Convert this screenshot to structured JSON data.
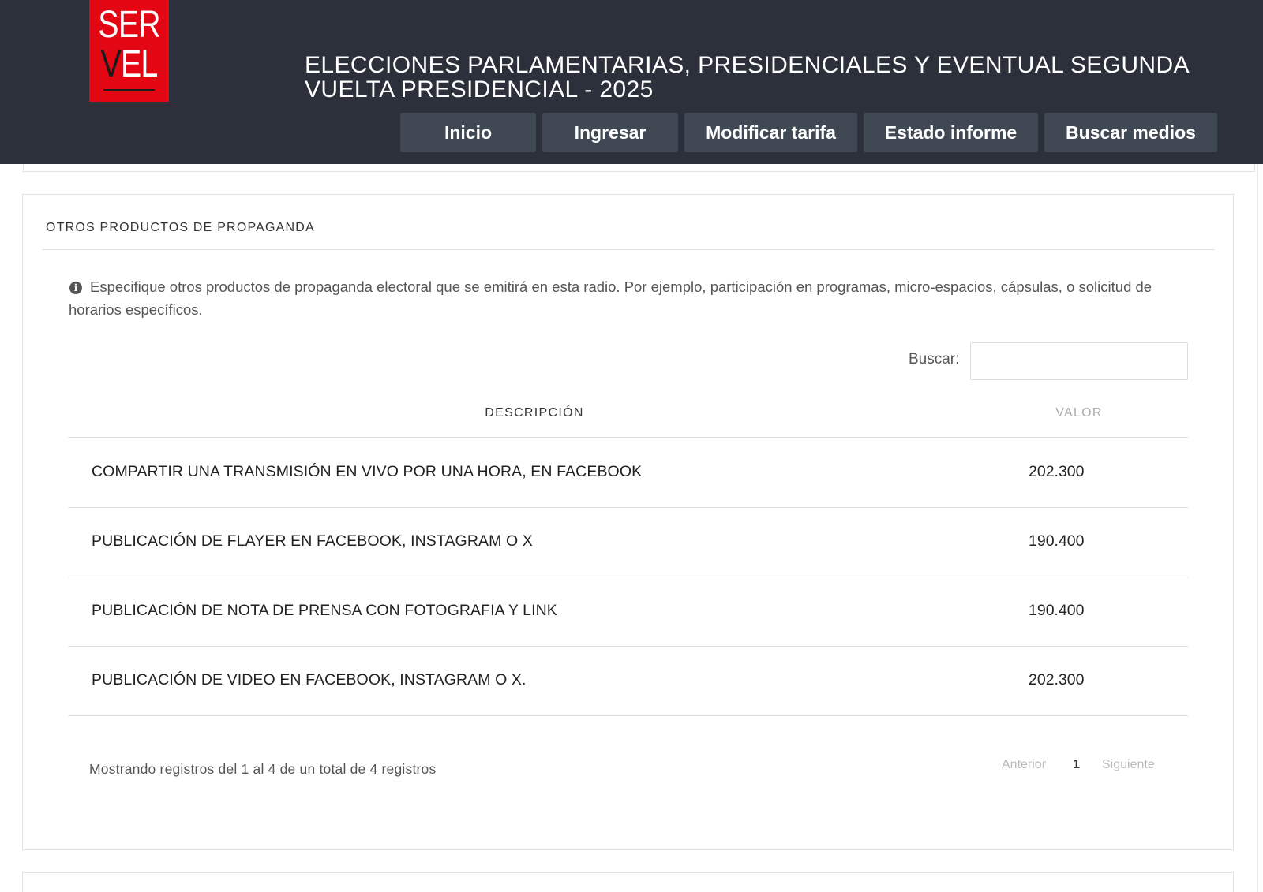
{
  "header": {
    "logo_line1": "SER",
    "logo_line2_v": "V",
    "logo_line2_rest": "EL",
    "title_line1": "ELECCIONES PARLAMENTARIAS, PRESIDENCIALES Y EVENTUAL SEGUNDA",
    "title_line2": "VUELTA PRESIDENCIAL - 2025",
    "nav": [
      "Inicio",
      "Ingresar",
      "Modificar tarifa",
      "Estado informe",
      "Buscar medios"
    ]
  },
  "panel": {
    "title": "OTROS PRODUCTOS DE PROPAGANDA",
    "info_text": "Especifique otros productos de propaganda electoral que se emitirá en esta radio. Por ejemplo, participación en programas, micro-espacios, cápsulas, o solicitud de horarios específicos.",
    "info_icon": "info-circle-icon",
    "search_label": "Buscar:",
    "search_value": "",
    "table": {
      "columns": [
        "DESCRIPCIÓN",
        "VALOR"
      ],
      "rows": [
        {
          "descripcion": "COMPARTIR UNA TRANSMISIÓN EN VIVO POR UNA HORA, EN FACEBOOK",
          "valor": "202.300"
        },
        {
          "descripcion": "PUBLICACIÓN DE FLAYER EN FACEBOOK, INSTAGRAM O X",
          "valor": "190.400"
        },
        {
          "descripcion": "PUBLICACIÓN DE NOTA DE PRENSA CON FOTOGRAFIA Y LINK",
          "valor": "190.400"
        },
        {
          "descripcion": "PUBLICACIÓN DE VIDEO EN FACEBOOK, INSTAGRAM O X.",
          "valor": "202.300"
        }
      ]
    },
    "footer_info": "Mostrando registros del 1 al 4 de un total de 4 registros",
    "pagination": {
      "prev": "Anterior",
      "current": "1",
      "next": "Siguiente"
    }
  },
  "colors": {
    "header_bg": "#2b303a",
    "nav_bg": "#3f4853",
    "logo_red": "#e30613"
  }
}
